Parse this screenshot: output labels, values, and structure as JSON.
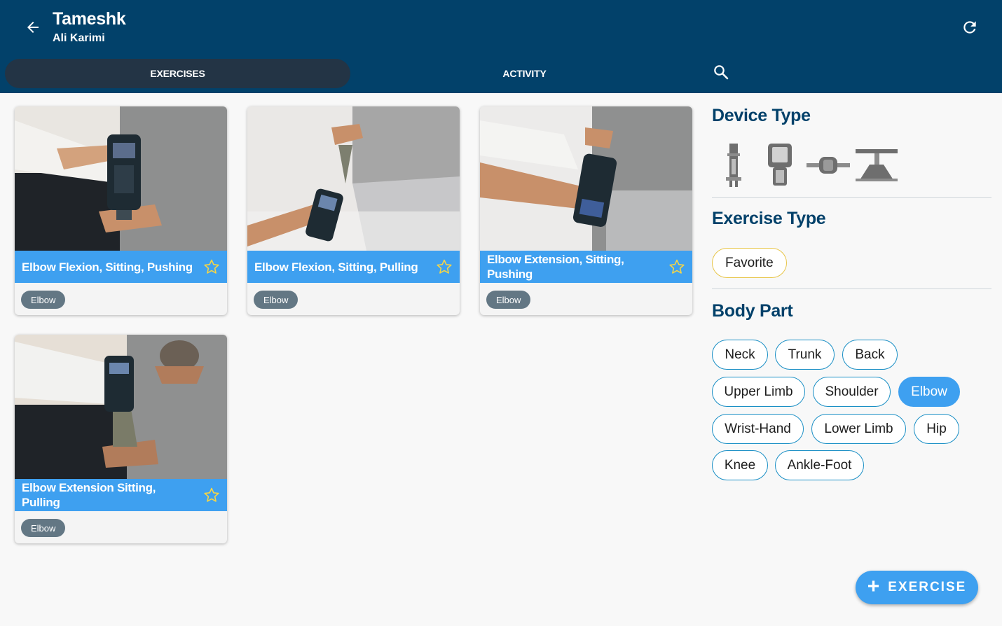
{
  "appbar": {
    "title": "Tameshk",
    "subtitle": "Ali Karimi",
    "back_icon": "arrow-left-icon",
    "refresh_icon": "refresh-icon",
    "background": "#02416a"
  },
  "tabs": [
    {
      "label": "EXERCISES",
      "selected": true
    },
    {
      "label": "ACTIVITY",
      "selected": false
    }
  ],
  "search_icon": "search-icon",
  "exercises": [
    {
      "title": "Elbow Flexion, Sitting, Pushing",
      "tag": "Elbow",
      "favorite": false,
      "image": "photo-therapist-device-pushing"
    },
    {
      "title": "Elbow Flexion, Sitting, Pulling",
      "tag": "Elbow",
      "favorite": false,
      "image": "photo-device-strap-pulling"
    },
    {
      "title": "Elbow Extension, Sitting, Pushing",
      "tag": "Elbow",
      "favorite": false,
      "image": "photo-device-extension-pushing"
    },
    {
      "title": "Elbow Extension Sitting, Pulling",
      "tag": "Elbow",
      "favorite": false,
      "image": "photo-device-extension-pulling"
    }
  ],
  "filters": {
    "device_type": {
      "heading": "Device Type",
      "icons": [
        "dynamometer-handheld-icon",
        "dynamometer-grip-icon",
        "dynamometer-inline-icon",
        "dynamometer-platform-icon"
      ]
    },
    "exercise_type": {
      "heading": "Exercise Type",
      "chips": [
        {
          "label": "Favorite",
          "selected": false
        }
      ]
    },
    "body_part": {
      "heading": "Body Part",
      "chips": [
        {
          "label": "Neck",
          "selected": false
        },
        {
          "label": "Trunk",
          "selected": false
        },
        {
          "label": "Back",
          "selected": false
        },
        {
          "label": "Upper Limb",
          "selected": false
        },
        {
          "label": "Shoulder",
          "selected": false
        },
        {
          "label": "Elbow",
          "selected": true
        },
        {
          "label": "Wrist-Hand",
          "selected": false
        },
        {
          "label": "Lower Limb",
          "selected": false
        },
        {
          "label": "Hip",
          "selected": false
        },
        {
          "label": "Knee",
          "selected": false
        },
        {
          "label": "Ankle-Foot",
          "selected": false
        }
      ]
    }
  },
  "fab": {
    "label": "EXERCISE",
    "icon": "plus-icon"
  },
  "colors": {
    "accent": "#3ea0f0",
    "chip_border": "#1a8fc5",
    "favorite_border": "#e8c64a",
    "tag_bg": "#637784",
    "selected_tab": "#233445"
  }
}
